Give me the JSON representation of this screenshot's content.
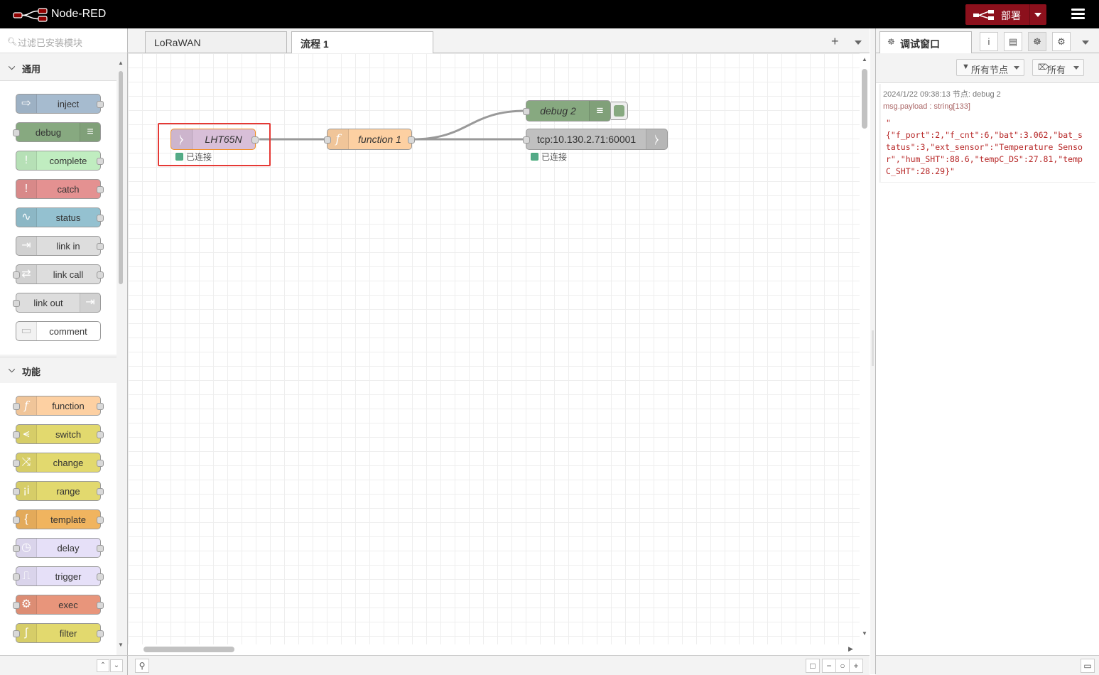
{
  "header": {
    "title": "Node-RED",
    "deploy_label": "部署"
  },
  "palette": {
    "search_placeholder": "过滤已安装模块",
    "categories": [
      {
        "title": "通用",
        "nodes": [
          {
            "label": "inject",
            "color": "#a6bbcf"
          },
          {
            "label": "debug",
            "color": "#87a980"
          },
          {
            "label": "complete",
            "color": "#c0edc0"
          },
          {
            "label": "catch",
            "color": "#e49191"
          },
          {
            "label": "status",
            "color": "#94c1d0"
          },
          {
            "label": "link in",
            "color": "#dddddd"
          },
          {
            "label": "link call",
            "color": "#dddddd"
          },
          {
            "label": "link out",
            "color": "#dddddd"
          },
          {
            "label": "comment",
            "color": "#ffffff"
          }
        ]
      },
      {
        "title": "功能",
        "nodes": [
          {
            "label": "function",
            "color": "#fdd0a2"
          },
          {
            "label": "switch",
            "color": "#e2d96e"
          },
          {
            "label": "change",
            "color": "#e2d96e"
          },
          {
            "label": "range",
            "color": "#e2d96e"
          },
          {
            "label": "template",
            "color": "#f0b45f"
          },
          {
            "label": "delay",
            "color": "#e6e0f8"
          },
          {
            "label": "trigger",
            "color": "#e6e0f8"
          },
          {
            "label": "exec",
            "color": "#e8957b"
          },
          {
            "label": "filter",
            "color": "#e2d96e"
          }
        ]
      }
    ]
  },
  "workspace": {
    "tabs": [
      {
        "label": "LoRaWAN"
      },
      {
        "label": "流程 1"
      }
    ],
    "nodes": {
      "lht": {
        "label": "LHT65N",
        "status": "已连接",
        "color": "#d8bfd8"
      },
      "func": {
        "label": "function 1",
        "color": "#fdd0a2"
      },
      "debug": {
        "label": "debug 2",
        "color": "#87a980"
      },
      "tcp": {
        "label": "tcp:10.130.2.71:60001",
        "status": "已连接",
        "color": "#c0c0c0"
      }
    }
  },
  "sidebar": {
    "tab_label": "调试窗口",
    "filter_nodes": "所有节点",
    "clear_label": "所有",
    "message": {
      "meta": "2024/1/22 09:38:13  节点: debug 2",
      "topic": "msg.payload : string[133]",
      "body": "\"\n{\"f_port\":2,\"f_cnt\":6,\"bat\":3.062,\"bat_status\":3,\"ext_sensor\":\"Temperature Sensor\",\"hum_SHT\":88.6,\"tempC_DS\":27.81,\"tempC_SHT\":28.29}\""
    }
  },
  "icons": [
    "logo-icon",
    "menu-icon",
    "search-icon",
    "zoom-out-icon",
    "zoom-reset-icon",
    "zoom-in-icon",
    "map-icon",
    "info-icon",
    "book-icon",
    "bug-icon",
    "gear-icon",
    "filter-icon",
    "trash-icon",
    "monitor-icon"
  ]
}
